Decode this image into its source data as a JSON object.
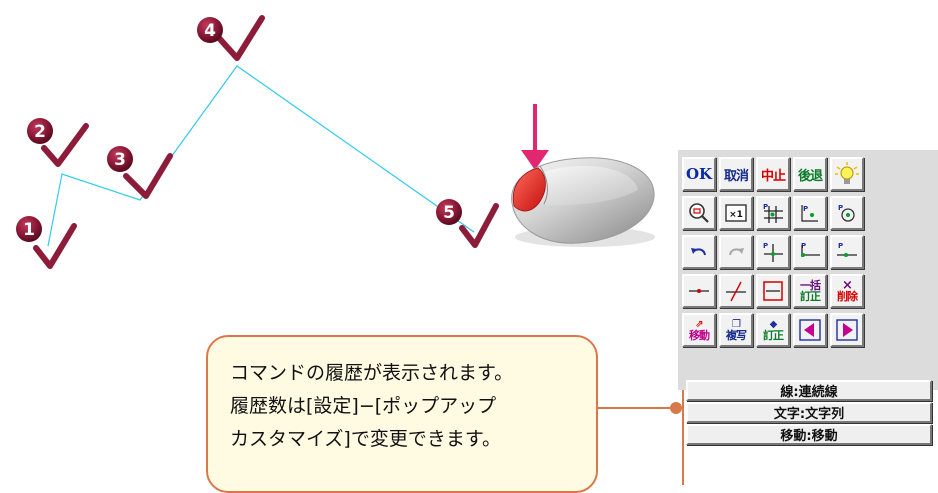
{
  "steps": [
    "1",
    "2",
    "3",
    "4",
    "5"
  ],
  "colors": {
    "polyline": "#33c9ee",
    "step_badge": "#7a1530",
    "checkmark": "#8c1c3a",
    "arrow": "#e2266f",
    "callout_border": "#d9784a",
    "callout_fill": "#fffbe3",
    "connector": "#d9784a"
  },
  "icons": {
    "mouse": "mouse-illustration",
    "arrow": "arrow-down-icon",
    "checkmark": "checkmark-icon"
  },
  "palette": {
    "ok": "OK",
    "cancel": "取消",
    "stop": "中止",
    "back": "後退",
    "hint_icon": "light-bulb-icon",
    "zoom_icon": "zoom-icon",
    "fit_icon": "fit-view-icon",
    "grid_snap_icon": "grid-snap-icon",
    "point_snap_icon": "point-snap-icon",
    "circle_center_icon": "circle-center-icon",
    "undo_icon": "undo-icon",
    "redo_icon": "redo-icon",
    "point_cross_icon": "point-cross-icon",
    "point_end_icon": "point-end-icon",
    "point_mid_icon": "point-mid-icon",
    "line_point_icon": "line-point-icon",
    "slash_icon": "slash-icon",
    "frame_icon": "frame-icon",
    "bulk_label_top": "一括",
    "bulk_label_bottom": "訂正",
    "delete_mark": "×",
    "delete_label": "削除",
    "move_label": "移動",
    "copy_label": "複写",
    "correct_label": "訂正",
    "prev_icon": "arrow-left-icon",
    "next_icon": "arrow-right-icon"
  },
  "history": [
    {
      "label": "線:連続線"
    },
    {
      "label": "文字:文字列"
    },
    {
      "label": "移動:移動"
    }
  ],
  "callout": {
    "line1": "コマンドの履歴が表示されます。",
    "line2": "履歴数は[設定]−[ポップアップ",
    "line3": "カスタマイズ]で変更できます。"
  }
}
